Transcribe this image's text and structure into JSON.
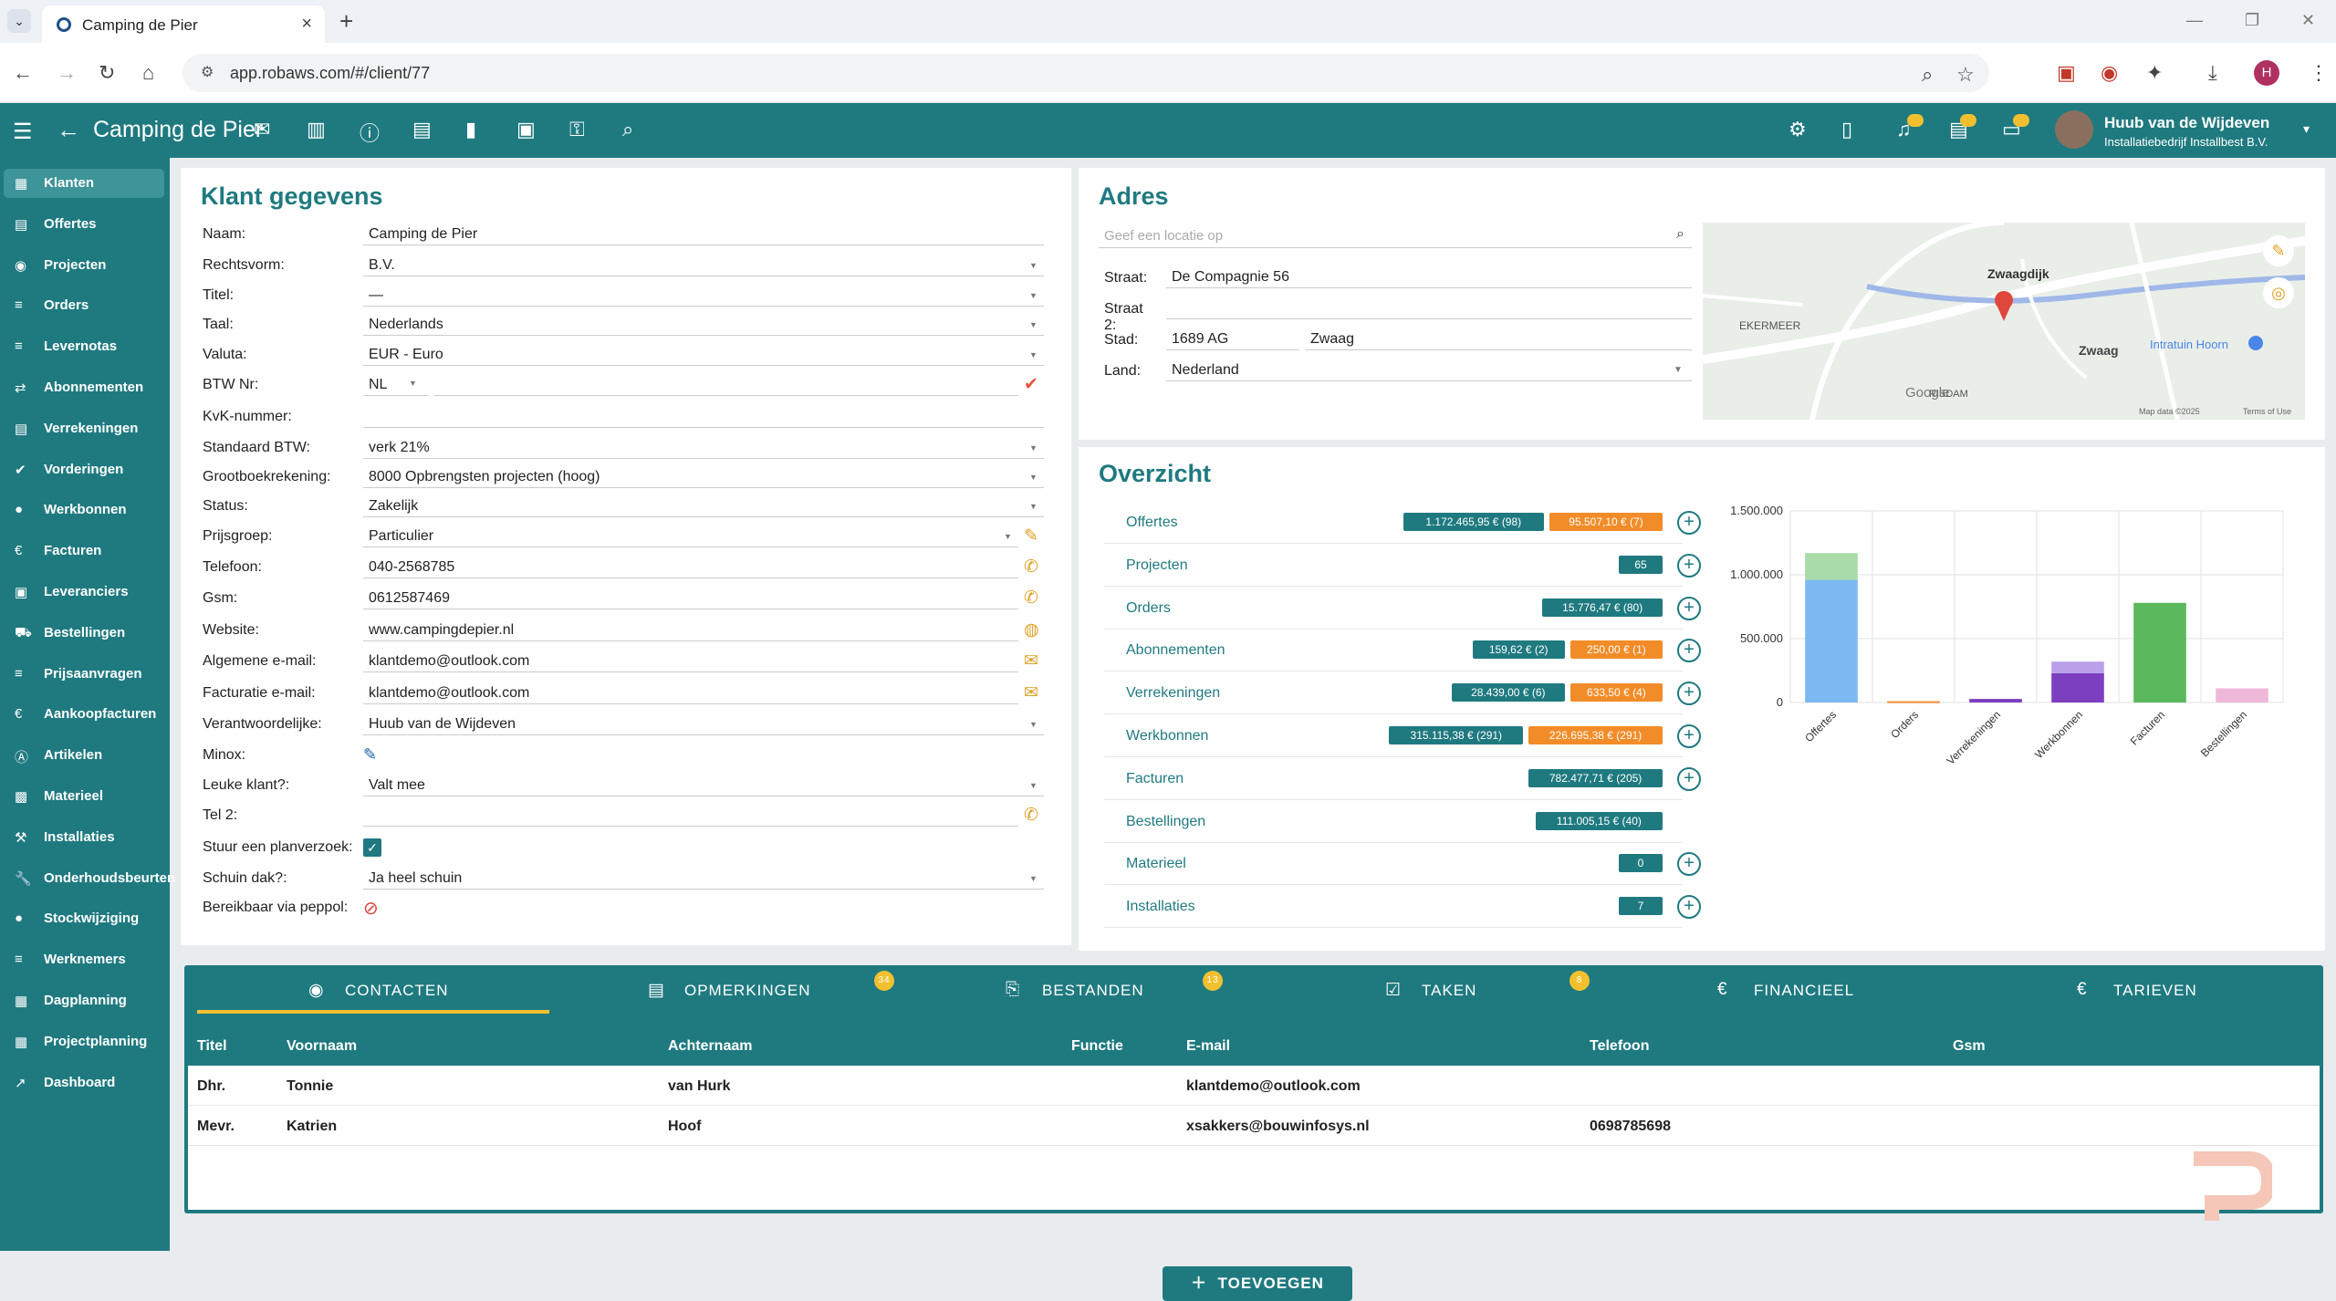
{
  "browser": {
    "tab_title": "Camping de Pier",
    "url": "app.robaws.com/#/client/77",
    "profile_initial": "H"
  },
  "appbar": {
    "title": "Camping de Pier",
    "user_name": "Huub van de Wijdeven",
    "user_company": "Installatiebedrijf Installbest B.V."
  },
  "sidebar": {
    "items": [
      {
        "label": "Klanten",
        "icon": "users-icon",
        "active": true
      },
      {
        "label": "Offertes",
        "icon": "document-icon"
      },
      {
        "label": "Projecten",
        "icon": "target-icon"
      },
      {
        "label": "Orders",
        "icon": "list-icon"
      },
      {
        "label": "Levernotas",
        "icon": "list-icon"
      },
      {
        "label": "Abonnementen",
        "icon": "repeat-icon"
      },
      {
        "label": "Verrekeningen",
        "icon": "document-icon"
      },
      {
        "label": "Vorderingen",
        "icon": "check-icon"
      },
      {
        "label": "Werkbonnen",
        "icon": "circle-icon"
      },
      {
        "label": "Facturen",
        "icon": "euro-icon"
      },
      {
        "label": "Leveranciers",
        "icon": "person-icon"
      },
      {
        "label": "Bestellingen",
        "icon": "cart-icon"
      },
      {
        "label": "Prijsaanvragen",
        "icon": "list-icon"
      },
      {
        "label": "Aankoopfacturen",
        "icon": "euro-icon"
      },
      {
        "label": "Artikelen",
        "icon": "a-icon"
      },
      {
        "label": "Materieel",
        "icon": "box-icon"
      },
      {
        "label": "Installaties",
        "icon": "tools-icon"
      },
      {
        "label": "Onderhoudsbeurten",
        "icon": "wrench-icon"
      },
      {
        "label": "Stockwijziging",
        "icon": "circle-icon"
      },
      {
        "label": "Werknemers",
        "icon": "list-icon"
      },
      {
        "label": "Dagplanning",
        "icon": "grid-icon"
      },
      {
        "label": "Projectplanning",
        "icon": "grid-icon"
      },
      {
        "label": "Dashboard",
        "icon": "trend-icon"
      }
    ]
  },
  "klant": {
    "title": "Klant gegevens",
    "fields": [
      {
        "label": "Naam:",
        "value": "Camping de Pier"
      },
      {
        "label": "Rechtsvorm:",
        "value": "B.V."
      },
      {
        "label": "Titel:",
        "value": "—"
      },
      {
        "label": "Taal:",
        "value": "Nederlands"
      },
      {
        "label": "Valuta:",
        "value": "EUR - Euro"
      },
      {
        "label": "BTW Nr:",
        "value": "NL"
      },
      {
        "label": "KvK-nummer:",
        "value": ""
      },
      {
        "label": "Standaard BTW:",
        "value": "verk 21%"
      },
      {
        "label": "Grootboekrekening:",
        "value": "8000 Opbrengsten projecten (hoog)"
      },
      {
        "label": "Status:",
        "value": "Zakelijk"
      },
      {
        "label": "Prijsgroep:",
        "value": "Particulier"
      },
      {
        "label": "Telefoon:",
        "value": "040-2568785"
      },
      {
        "label": "Gsm:",
        "value": "0612587469"
      },
      {
        "label": "Website:",
        "value": "www.campingdepier.nl"
      },
      {
        "label": "Algemene e-mail:",
        "value": "klantdemo@outlook.com"
      },
      {
        "label": "Facturatie e-mail:",
        "value": "klantdemo@outlook.com"
      },
      {
        "label": "Verantwoordelijke:",
        "value": "Huub van de Wijdeven"
      },
      {
        "label": "Minox:",
        "value": ""
      },
      {
        "label": "Leuke klant?:",
        "value": "Valt mee"
      },
      {
        "label": "Tel 2:",
        "value": ""
      },
      {
        "label": "Stuur een planverzoek:",
        "value": ""
      },
      {
        "label": "Schuin dak?:",
        "value": "Ja heel schuin"
      },
      {
        "label": "Bereikbaar via peppol:",
        "value": ""
      }
    ]
  },
  "adres": {
    "title": "Adres",
    "search_placeholder": "Geef een locatie op",
    "straat_label": "Straat:",
    "straat": "De Compagnie 56",
    "straat2_label": "Straat 2:",
    "straat2": "",
    "stad_label": "Stad:",
    "postcode": "1689 AG",
    "stad": "Zwaag",
    "land_label": "Land:",
    "land": "Nederland",
    "map_labels": [
      "Zwaagdijk",
      "Zwaag",
      "Intratuin Hoorn",
      "RISDAM",
      "EKERMEER",
      "Google",
      "Map data ©2025",
      "Terms of Use"
    ]
  },
  "overzicht": {
    "title": "Overzicht",
    "rows": [
      {
        "label": "Offertes",
        "pills": [
          {
            "text": "1.172.465,95 € (98)",
            "color": "teal"
          },
          {
            "text": "95.507,10 € (7)",
            "color": "orange"
          }
        ],
        "plus": true
      },
      {
        "label": "Projecten",
        "pills": [
          {
            "text": "65",
            "color": "teal"
          }
        ],
        "plus": true
      },
      {
        "label": "Orders",
        "pills": [
          {
            "text": "15.776,47 € (80)",
            "color": "teal"
          }
        ],
        "plus": true
      },
      {
        "label": "Abonnementen",
        "pills": [
          {
            "text": "159,62 € (2)",
            "color": "teal"
          },
          {
            "text": "250,00 € (1)",
            "color": "orange"
          }
        ],
        "plus": true
      },
      {
        "label": "Verrekeningen",
        "pills": [
          {
            "text": "28.439,00 € (6)",
            "color": "teal"
          },
          {
            "text": "633,50 € (4)",
            "color": "orange"
          }
        ],
        "plus": true
      },
      {
        "label": "Werkbonnen",
        "pills": [
          {
            "text": "315.115,38 € (291)",
            "color": "teal"
          },
          {
            "text": "226.695,38 € (291)",
            "color": "orange"
          }
        ],
        "plus": true
      },
      {
        "label": "Facturen",
        "pills": [
          {
            "text": "782.477,71 € (205)",
            "color": "teal"
          }
        ],
        "plus": true
      },
      {
        "label": "Bestellingen",
        "pills": [
          {
            "text": "111.005,15 € (40)",
            "color": "teal"
          }
        ],
        "plus": false
      },
      {
        "label": "Materieel",
        "pills": [
          {
            "text": "0",
            "color": "teal"
          }
        ],
        "plus": true
      },
      {
        "label": "Installaties",
        "pills": [
          {
            "text": "7",
            "color": "teal"
          }
        ],
        "plus": true
      }
    ]
  },
  "chart_data": {
    "type": "bar",
    "categories": [
      "Offertes",
      "Orders",
      "Verrekeningen",
      "Werkbonnen",
      "Facturen",
      "Bestellingen"
    ],
    "series": [
      {
        "values": [
          960000,
          10000,
          28000,
          230000,
          780000,
          0
        ],
        "colors": [
          "#7cb8f2",
          "#f28c28",
          "#7b3fbf",
          "#7b3fbf",
          "#5cb85c",
          "#e8a0c8"
        ]
      },
      {
        "values": [
          210000,
          0,
          0,
          90000,
          0,
          111000
        ],
        "colors": [
          "#a8dba8",
          "#f28c28",
          "#7b3fbf",
          "#b9a0e8",
          "#5cb85c",
          "#f0b8d8"
        ]
      }
    ],
    "yticks": [
      "0",
      "500.000",
      "1.000.000",
      "1.500.000"
    ],
    "ylim": [
      0,
      1500000
    ]
  },
  "bottom": {
    "tabs": [
      {
        "label": "CONTACTEN",
        "icon": "person-circle-icon",
        "badge": ""
      },
      {
        "label": "OPMERKINGEN",
        "icon": "comment-icon",
        "badge": "34"
      },
      {
        "label": "BESTANDEN",
        "icon": "paperclip-icon",
        "badge": "13"
      },
      {
        "label": "TAKEN",
        "icon": "checkbox-icon",
        "badge": "8"
      },
      {
        "label": "FINANCIEEL",
        "icon": "euro-icon",
        "badge": ""
      },
      {
        "label": "TARIEVEN",
        "icon": "euro-icon",
        "badge": ""
      }
    ],
    "columns": [
      "Titel",
      "Voornaam",
      "Achternaam",
      "Functie",
      "E-mail",
      "Telefoon",
      "Gsm"
    ],
    "rows": [
      [
        "Dhr.",
        "Tonnie",
        "van Hurk",
        "",
        "klantdemo@outlook.com",
        "",
        ""
      ],
      [
        "Mevr.",
        "Katrien",
        "Hoof",
        "",
        "xsakkers@bouwinfosys.nl",
        "0698785698",
        ""
      ]
    ],
    "add_label": "TOEVOEGEN"
  }
}
